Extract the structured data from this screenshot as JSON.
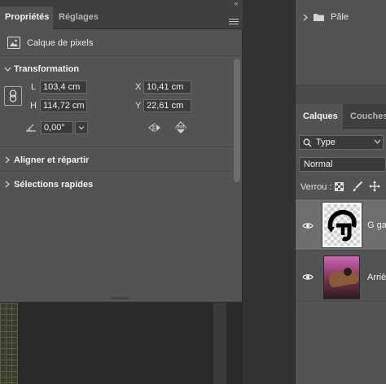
{
  "properties_panel": {
    "tabs": [
      {
        "label": "Propriétés",
        "active": true
      },
      {
        "label": "Réglages",
        "active": false
      }
    ],
    "layer_type": "Calque de pixels",
    "transform": {
      "title": "Transformation",
      "L": {
        "label": "L",
        "value": "103,4 cm"
      },
      "H": {
        "label": "H",
        "value": "114,72 cm"
      },
      "X": {
        "label": "X",
        "value": "10,41 cm"
      },
      "Y": {
        "label": "Y",
        "value": "22,61 cm"
      },
      "angle": "0,00°"
    },
    "sections": {
      "align": "Aligner et répartir",
      "quick_selections": "Sélections rapides"
    }
  },
  "paths_panel": {
    "folder_label": "Pâle"
  },
  "layers_panel": {
    "tabs": [
      {
        "label": "Calques",
        "active": true
      },
      {
        "label": "Couches",
        "active": false
      }
    ],
    "filter": "Type",
    "blend_mode": "Normal",
    "lock_label": "Verrou :",
    "layers": [
      {
        "name": "G gal",
        "visible": true,
        "selected": true
      },
      {
        "name": "Arriè",
        "visible": true,
        "selected": false
      }
    ]
  },
  "colors": {
    "panel_bg": "#535353",
    "tabbar_bg": "#3f3f3f",
    "field_bg": "#3b3b3b",
    "selected_layer": "#6e6e6e"
  }
}
